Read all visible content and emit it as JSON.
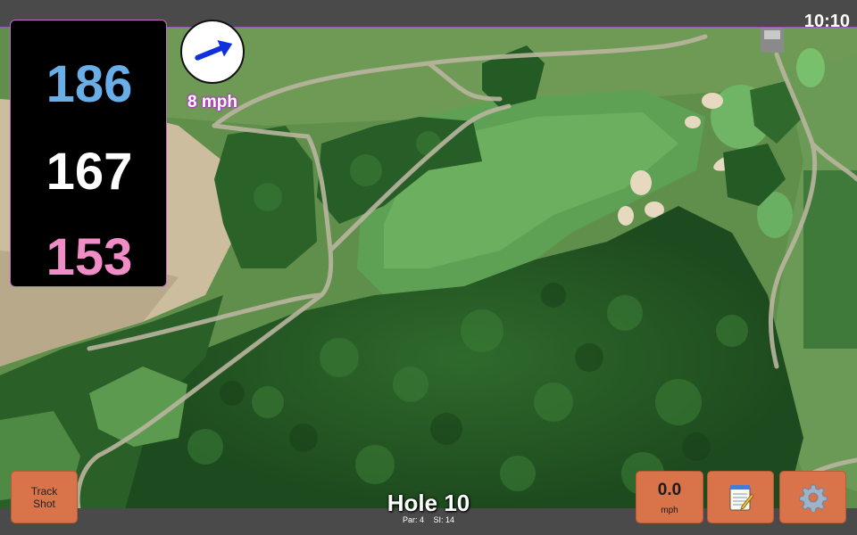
{
  "status": {
    "time": "10:10"
  },
  "distances": {
    "back": "186",
    "middle": "167",
    "front": "153"
  },
  "wind": {
    "speed_text": "8 mph",
    "icon": "wind-direction-arrow-icon"
  },
  "hole": {
    "title": "Hole 10",
    "par": "Par: 4",
    "stroke_index": "SI: 14"
  },
  "buttons": {
    "track_shot": "Track\nShot",
    "speed_value": "0.0",
    "speed_unit": "mph",
    "notes_icon": "notepad-icon",
    "settings_icon": "gear-icon"
  },
  "colors": {
    "back_distance": "#6aaee8",
    "middle_distance": "#ffffff",
    "front_distance": "#f08cc6",
    "button": "#d9744a"
  }
}
